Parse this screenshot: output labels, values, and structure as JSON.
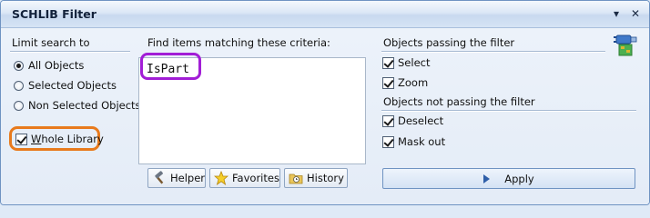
{
  "window": {
    "title": "SCHLIB Filter",
    "controls": {
      "dropdown": "▾",
      "pin": "✕"
    }
  },
  "limit_search": {
    "label": "Limit search to",
    "options": [
      {
        "label": "All Objects",
        "checked": true
      },
      {
        "label": "Selected Objects",
        "checked": false
      },
      {
        "label": "Non Selected Objects",
        "checked": false
      }
    ],
    "whole_library": {
      "label": "Whole Library",
      "checked": true
    }
  },
  "criteria": {
    "label": "Find items matching these criteria:",
    "query": "IsPart"
  },
  "buttons": {
    "helper": "Helper",
    "favorites": "Favorites",
    "history": "History",
    "apply": "Apply"
  },
  "passing": {
    "label": "Objects passing the filter",
    "items": [
      {
        "label": "Select",
        "checked": true
      },
      {
        "label": "Zoom",
        "checked": true
      }
    ]
  },
  "not_passing": {
    "label": "Objects not passing the filter",
    "items": [
      {
        "label": "Deselect",
        "checked": true
      },
      {
        "label": "Mask out",
        "checked": true
      }
    ]
  },
  "colors": {
    "highlight_criteria": "#a21ed6",
    "highlight_whole_library": "#e87a1c",
    "panel_bg": "#e4ecf7"
  }
}
